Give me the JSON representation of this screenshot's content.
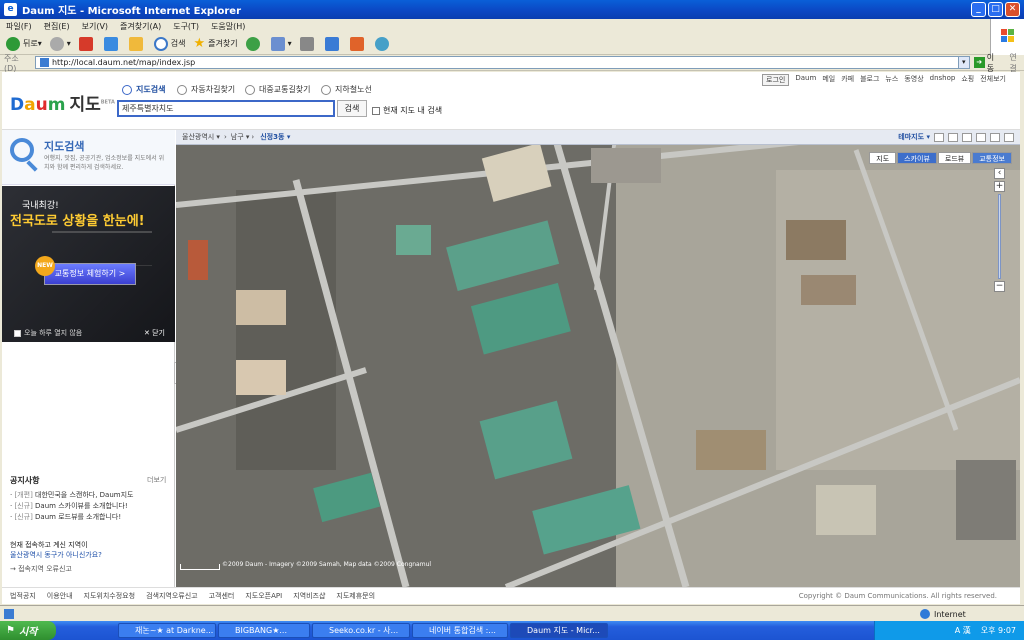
{
  "window": {
    "title": "Daum 지도 - Microsoft Internet Explorer"
  },
  "menu": [
    "파일(F)",
    "편집(E)",
    "보기(V)",
    "즐겨찾기(A)",
    "도구(T)",
    "도움말(H)"
  ],
  "toolbar": {
    "back": "뒤로",
    "search": "검색",
    "favorites": "즐겨찾기"
  },
  "address": {
    "label": "주소(D)",
    "url": "http://local.daum.net/map/index.jsp",
    "go": "이동",
    "links": "연결"
  },
  "top_links": {
    "login": "로그인",
    "items": [
      "Daum",
      "메일",
      "카페",
      "블로그",
      "뉴스",
      "동영상",
      "dnshop",
      "쇼핑",
      "전체보기"
    ]
  },
  "logo": {
    "d": "D",
    "a": "a",
    "u": "u",
    "m": "m",
    "map": "지도",
    "beta": "BETA"
  },
  "nav": {
    "map_search": "지도검색",
    "car_route": "자동차길찾기",
    "transit_route": "대중교통길찾기",
    "subway": "지하철노선"
  },
  "search": {
    "value": "제주특별자치도",
    "button": "검색",
    "within_map": "현재 지도 내 검색"
  },
  "left": {
    "title": "지도검색",
    "desc": "여행지, 맛집, 공공기관, 업소정보를 지도에서 위치와 함께 편리하게 검색하세요.",
    "ad_line1": "국내최강!",
    "ad_line2": "전국도로 상황을 한눈에!",
    "ad_new": "NEW",
    "ad_button": "교통정보 체험하기 >",
    "ad_dont_open": "오늘 하루 열지 않음",
    "ad_close": "닫기",
    "notice_title": "공지사항",
    "notice_more": "더보기",
    "notices": [
      {
        "tag": "[개편]",
        "text": "대한민국을 스캔하다, Daum지도"
      },
      {
        "tag": "[신규]",
        "text": "Daum 스카이뷰를 소개합니다!"
      },
      {
        "tag": "[신규]",
        "text": "Daum 로드뷰를 소개합니다!"
      }
    ],
    "curloc_line1": "현재 접속하고 계신 지역이",
    "curloc_line2": "울산광역시 동구가 아니신가요?",
    "report": "→ 접속지역 오류신고"
  },
  "map": {
    "breadcrumb": [
      "울산광역시 ▾",
      "남구 ▾"
    ],
    "current": "신정3동 ▾",
    "theme": "테마지도 ▾",
    "views": [
      "지도",
      "스카이뷰",
      "로드뷰",
      "교통정보"
    ],
    "active_view": "스카이뷰",
    "copyright": "©2009 Daum - Imagery ©2009 Samah, Map data ©2009 Congnamul"
  },
  "footer": {
    "links": [
      "법적공지",
      "이용안내",
      "지도위치수정요청",
      "검색지역오류신고",
      "고객센터",
      "지도오픈API",
      "지역비즈샵",
      "지도제휴문의"
    ],
    "copyright": "Copyright © Daum Communications. All rights reserved."
  },
  "status": {
    "zone": "Internet"
  },
  "taskbar": {
    "start": "시작",
    "tasks": [
      "재논~★ at Darkne...",
      "BIGBANG★...",
      "Seeko.co.kr - 사...",
      "네이버 통합검색 :...",
      "Daum 지도 - Micr..."
    ],
    "clock": "오후 9:07",
    "ime": "A 漢"
  }
}
